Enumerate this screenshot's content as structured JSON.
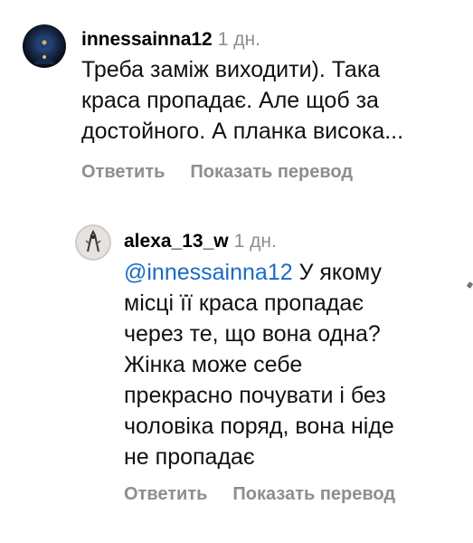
{
  "comments": [
    {
      "username": "innessainna12",
      "time": "1 дн.",
      "lines": [
        "Треба заміж виходити). Така",
        "краса пропадає. Але щоб за",
        "достойного. А планка висока..."
      ],
      "reply_label": "Ответить",
      "translate_label": "Показать перевод",
      "avatar_icon": "profile-avatar-icon"
    },
    {
      "username": "alexa_13_w",
      "time": "1 дн.",
      "mention": "@innessainna12",
      "first_line_rest": " У якому",
      "lines": [
        "місці її краса пропадає",
        "через те, що вона одна?",
        "Жінка може себе",
        "прекрасно почувати і без",
        "чоловіка поряд, вона ніде",
        "не пропадає"
      ],
      "reply_label": "Ответить",
      "translate_label": "Показать перевод",
      "avatar_icon": "profile-avatar-icon"
    }
  ],
  "colors": {
    "text": "#111111",
    "muted": "#8e8e8e",
    "mention": "#1a6bc2"
  }
}
